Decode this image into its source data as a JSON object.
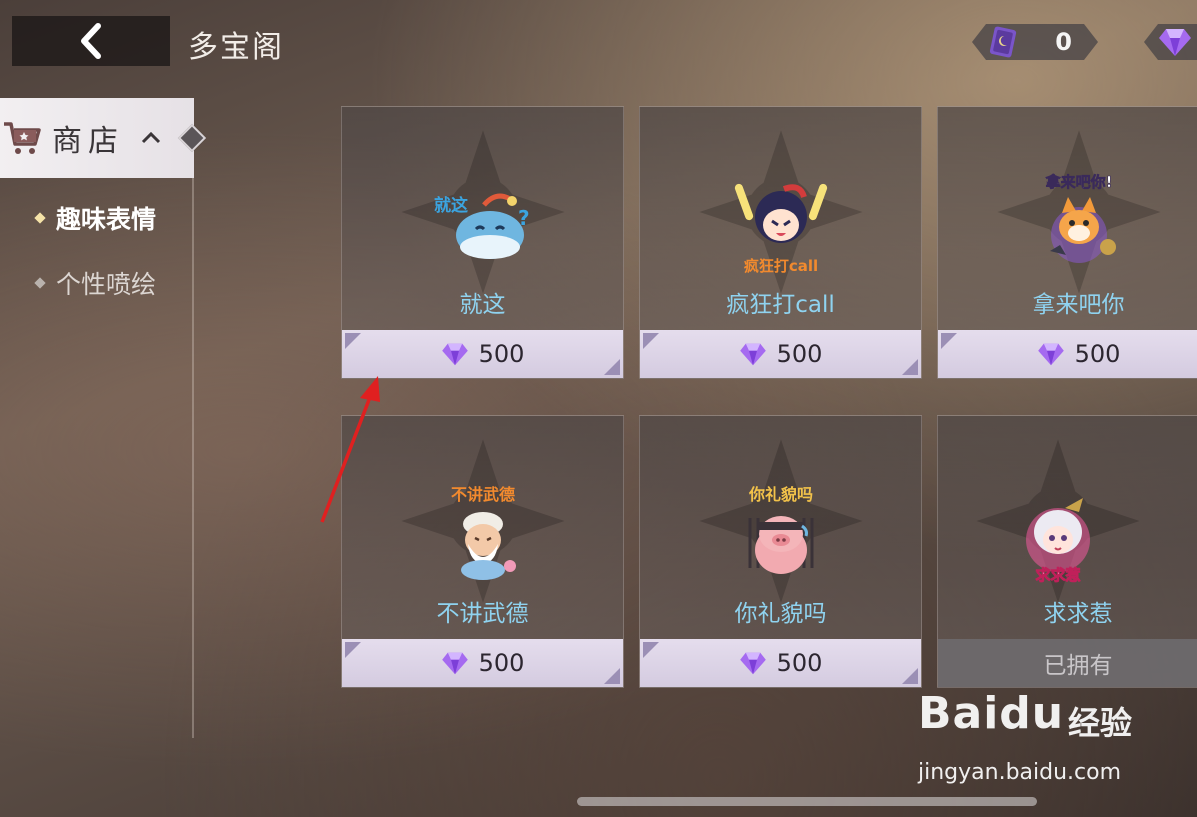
{
  "header": {
    "title": "多宝阁",
    "card_currency_value": "0"
  },
  "sidebar": {
    "shop_label": "商店",
    "items": [
      {
        "label": "趣味表情",
        "active": true
      },
      {
        "label": "个性喷绘",
        "active": false
      }
    ]
  },
  "cards": [
    {
      "name": "就这",
      "price": "500",
      "owned": false,
      "sticker_icon": "whale-sticker-icon"
    },
    {
      "name": "疯狂打call",
      "price": "500",
      "owned": false,
      "sticker_icon": "cheer-girl-sticker-icon"
    },
    {
      "name": "拿来吧你",
      "price": "500",
      "owned": false,
      "sticker_icon": "cat-sticker-icon"
    },
    {
      "name": "不讲武德",
      "price": "500",
      "owned": false,
      "sticker_icon": "old-man-sticker-icon"
    },
    {
      "name": "你礼貌吗",
      "price": "500",
      "owned": false,
      "sticker_icon": "pig-sticker-icon"
    },
    {
      "name": "求求惹",
      "price": "",
      "owned": true,
      "owned_label": "已拥有",
      "sticker_icon": "pleading-girl-sticker-icon"
    }
  ],
  "sticker_texts": {
    "whale": "就这",
    "cheer": "疯狂打call",
    "cat": "拿来吧你!",
    "oldman": "不讲武德",
    "pig": "你礼貌吗",
    "girl": "求求惹"
  },
  "watermark": {
    "brand": "Baidu",
    "cn": "经验",
    "url": "jingyan.baidu.com"
  },
  "colors": {
    "card_name": "#8fd3f0",
    "gem": "#8a4fe0",
    "price_bar": "#e5dded",
    "annotation_arrow": "#e02020"
  }
}
